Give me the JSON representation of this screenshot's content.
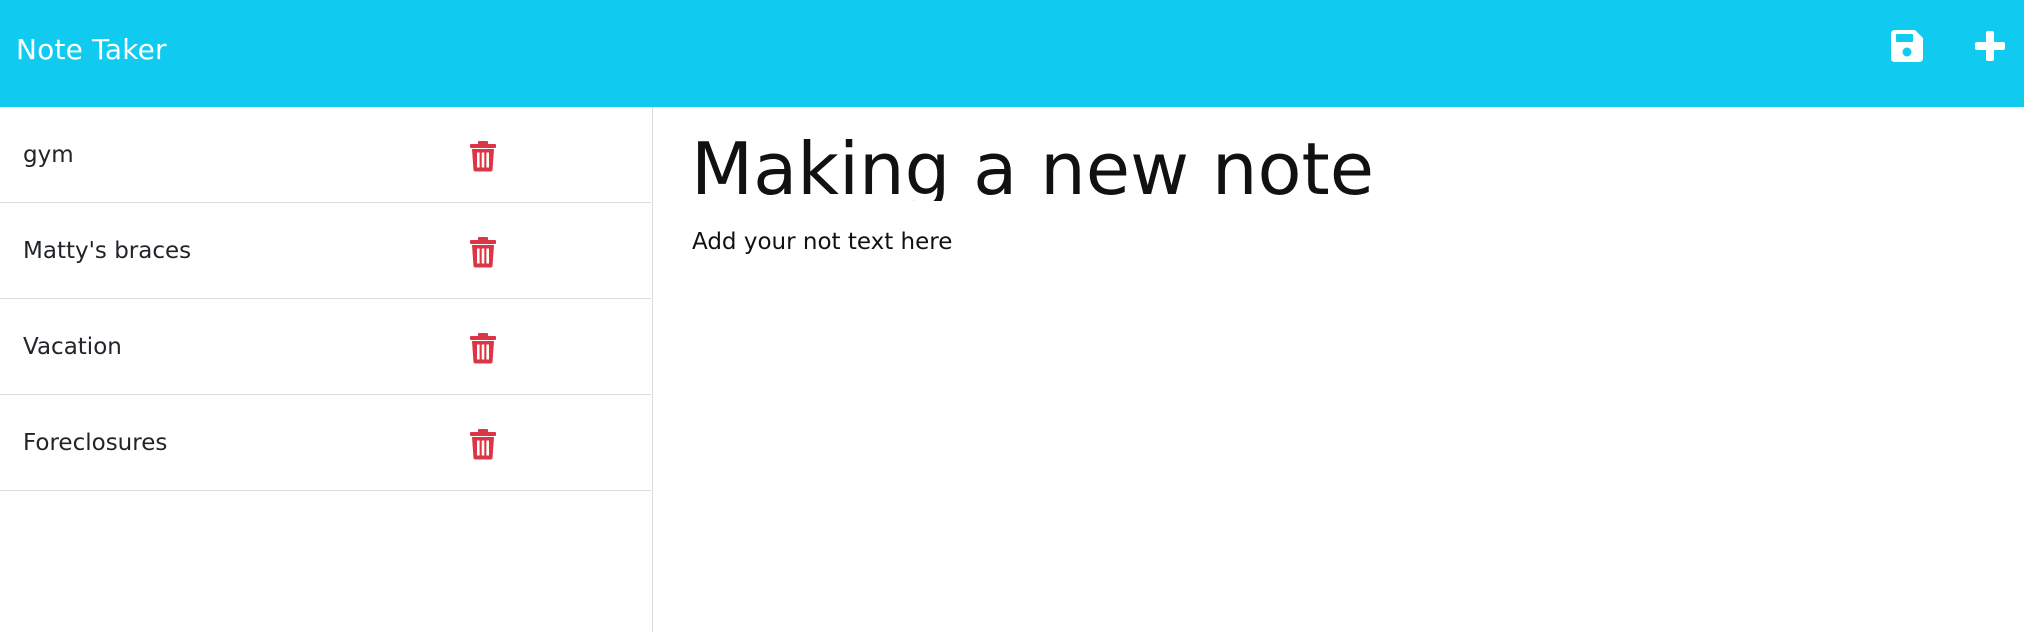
{
  "app": {
    "title": "Note Taker",
    "accent_color": "#10cbef",
    "delete_color": "#dc3545"
  },
  "header": {
    "actions": [
      {
        "icon": "floppy-disk-save-icon",
        "label": ""
      },
      {
        "icon": "plus-icon",
        "label": ""
      }
    ]
  },
  "sidebar": {
    "items": [
      {
        "title": "gym",
        "icon": "trash-icon"
      },
      {
        "title": "Matty's braces",
        "icon": "trash-icon"
      },
      {
        "title": "Vacation",
        "icon": "trash-icon"
      },
      {
        "title": "Foreclosures",
        "icon": "trash-icon"
      }
    ]
  },
  "editor": {
    "title_value": "Making a new note",
    "text_value": "Add your not text here"
  }
}
